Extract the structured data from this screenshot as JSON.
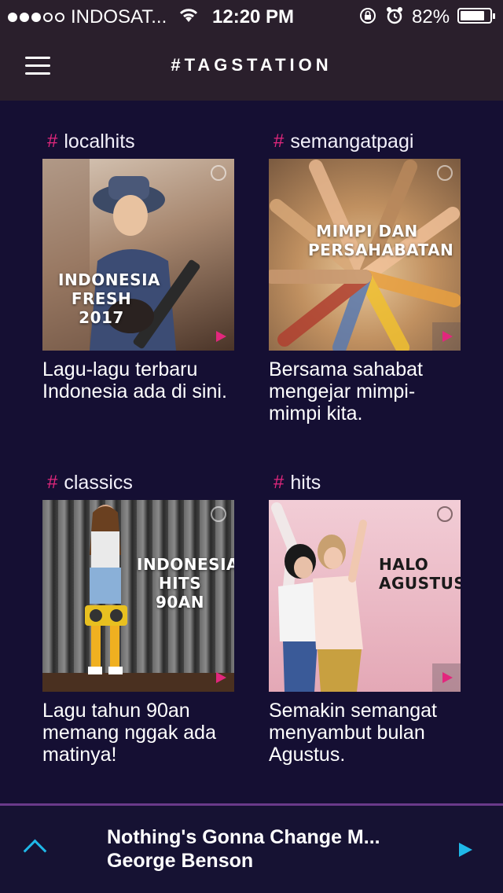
{
  "status_bar": {
    "carrier": "INDOSAT...",
    "signal_bars_filled": 3,
    "signal_bars_total": 5,
    "time": "12:20 PM",
    "battery_percent": "82%",
    "battery_level": 0.82
  },
  "header": {
    "title": "#TAGSTATION",
    "menu_icon": "hamburger-icon"
  },
  "stations": [
    {
      "hash": "#",
      "tag": "localhits",
      "art_title_line1": "INDONESIA",
      "art_title_line2": "FRESH 2017",
      "description": "Lagu-lagu terbaru Indonesia ada di sini.",
      "art_colors": [
        "#c9b7a6",
        "#6b4b3a"
      ]
    },
    {
      "hash": "#",
      "tag": "semangatpagi",
      "art_title_line1": "MIMPI DAN",
      "art_title_line2": "PERSAHABATAN",
      "description": "Bersama sahabat mengejar mimpi-mimpi kita.",
      "art_colors": [
        "#d9b48a",
        "#8a6a4c"
      ]
    },
    {
      "hash": "#",
      "tag": "classics",
      "art_title_line1": "INDONESIA",
      "art_title_line2": "HITS 90AN",
      "description": "Lagu tahun 90an memang nggak ada matinya!",
      "art_colors": [
        "#5a5a5a",
        "#1e1e1e"
      ]
    },
    {
      "hash": "#",
      "tag": "hits",
      "art_title_line1": "HALO",
      "art_title_line2": "AGUSTUS!",
      "description": "Semakin semangat menyambut bulan Agustus.",
      "art_colors": [
        "#f0c6d0",
        "#d89aa8"
      ]
    }
  ],
  "player": {
    "song": "Nothing's Gonna Change M...",
    "artist": "George Benson",
    "expand_icon": "chevron-up-icon",
    "play_icon": "play-icon"
  },
  "colors": {
    "background": "#150f33",
    "header": "#2a1f2c",
    "accent_pink": "#e2277d",
    "accent_blue": "#1fb8e8"
  }
}
